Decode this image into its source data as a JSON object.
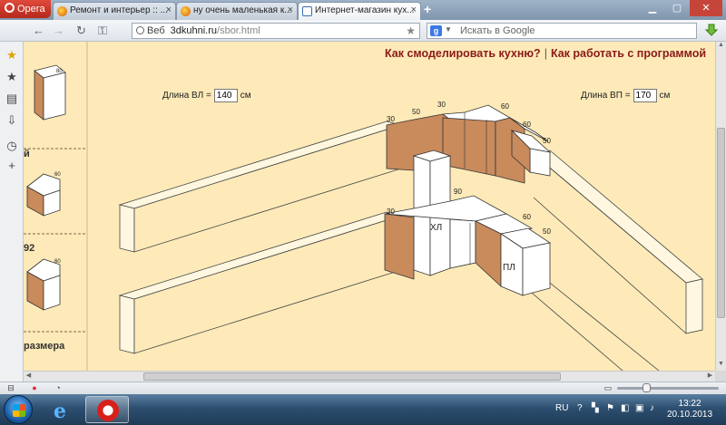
{
  "browser": {
    "menu_label": "Opera",
    "tabs": [
      {
        "label": "Ремонт и интерьер :: ...",
        "active": false
      },
      {
        "label": "ну очень маленькая к...",
        "active": false
      },
      {
        "label": "Интернет-магазин кух...",
        "active": true
      }
    ],
    "new_tab_label": "+",
    "address": {
      "mode_label": "Веб",
      "domain": "3dkuhni.ru",
      "path": "/sbor.html"
    },
    "search": {
      "placeholder": "Искать в Google",
      "engine_letter": "g"
    }
  },
  "page": {
    "header_link_1": "Как смоделировать кухню?",
    "header_separator": "|",
    "header_link_2": "Как работать с программой",
    "left_length": {
      "label": "Длина ВЛ =",
      "value": "140",
      "unit": "см"
    },
    "right_length": {
      "label": "Длина ВП =",
      "value": "170",
      "unit": "см"
    },
    "sidebar": {
      "label_1": "й",
      "label_2": "92",
      "label_3": "размера",
      "thumb_dims": [
        "80",
        "60",
        "60"
      ]
    },
    "drawing": {
      "upper_dims": [
        "30",
        "50",
        "30",
        "60",
        "60",
        "50"
      ],
      "lower_dims": [
        "30",
        "90",
        "60",
        "50"
      ],
      "label_left": "ХЛ",
      "label_right": "ПЛ"
    }
  },
  "taskbar": {
    "language": "RU",
    "time": "13:22",
    "date": "20.10.2013"
  }
}
